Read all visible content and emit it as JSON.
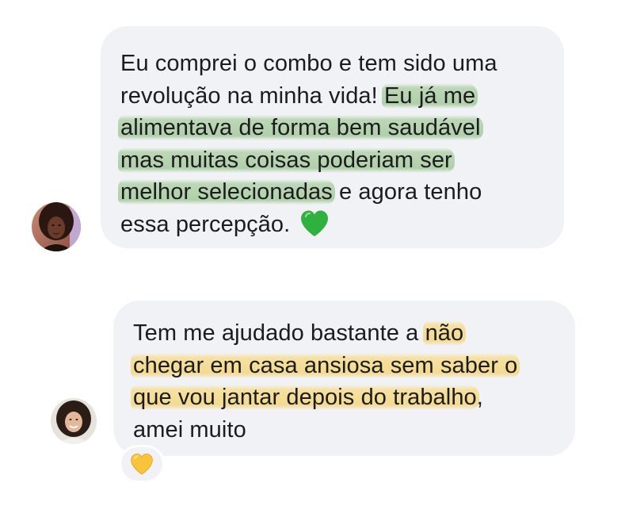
{
  "conversation": {
    "messages": [
      {
        "avatar_icon": "woman-curly-hair-avatar-icon",
        "lines": [
          [
            {
              "text": "Eu comprei o combo e tem sido uma",
              "highlight": null
            }
          ],
          [
            {
              "text": "revolução na minha vida! ",
              "highlight": null
            },
            {
              "text": "Eu já me",
              "highlight": "green"
            }
          ],
          [
            {
              "text": "alimentava de forma bem saudável",
              "highlight": "green"
            }
          ],
          [
            {
              "text": "mas muitas coisas poderiam ser",
              "highlight": "green"
            }
          ],
          [
            {
              "text": "melhor selecionadas",
              "highlight": "green"
            },
            {
              "text": " e agora tenho",
              "highlight": null
            }
          ],
          [
            {
              "text": "essa percepção. ",
              "highlight": null
            }
          ]
        ],
        "emoji_icon": "green-heart-icon"
      },
      {
        "avatar_icon": "woman-smiling-avatar-icon",
        "lines": [
          [
            {
              "text": "Tem me ajudado bastante a ",
              "highlight": null
            },
            {
              "text": "não",
              "highlight": "yellow"
            }
          ],
          [
            {
              "text": "chegar em casa ansiosa sem saber o",
              "highlight": "yellow"
            }
          ],
          [
            {
              "text": "que vou jantar depois do trabalho",
              "highlight": "yellow"
            },
            {
              "text": ",",
              "highlight": null
            }
          ],
          [
            {
              "text": "amei muito",
              "highlight": null
            }
          ]
        ],
        "reaction_icon": "yellow-heart-icon"
      }
    ]
  },
  "colors": {
    "bubble_background": "#f1f2f5",
    "highlight_green": "#a9cea0",
    "highlight_yellow": "#f6dc8c",
    "text": "#1c1c1e",
    "green_heart": "#2fb13f",
    "yellow_heart": "#f9c43a"
  }
}
